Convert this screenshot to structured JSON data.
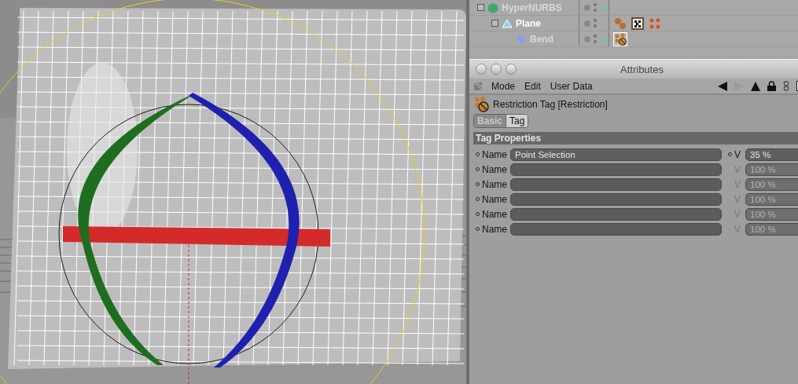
{
  "objects": [
    {
      "name": "HyperNURBS",
      "selected": false,
      "checked": true,
      "kind": "nurbs",
      "children": [
        {
          "name": "Plane",
          "selected": true,
          "checked": false,
          "kind": "plane",
          "tags": [
            {
              "kind": "balls",
              "selected": false
            },
            {
              "kind": "checker",
              "selected": false
            },
            {
              "kind": "dots",
              "selected": false
            }
          ],
          "children": [
            {
              "name": "Bend",
              "selected": false,
              "checked": true,
              "kind": "bend",
              "tags": [
                {
                  "kind": "restriction",
                  "selected": true
                }
              ]
            }
          ]
        }
      ]
    }
  ],
  "attributes": {
    "title": "Attributes",
    "menu": [
      "Mode",
      "Edit",
      "User Data"
    ],
    "object_title": "Restriction Tag [Restriction]",
    "tabs": [
      {
        "label": "Basic",
        "selected": false
      },
      {
        "label": "Tag",
        "selected": true
      }
    ],
    "section": "Tag Properties",
    "rows": [
      {
        "label": "Name",
        "value": "Point Selection",
        "v_label": "V",
        "v_value": "35 %",
        "disabled": false
      },
      {
        "label": "Name",
        "value": "",
        "v_label": "V",
        "v_value": "100 %",
        "disabled": true
      },
      {
        "label": "Name",
        "value": "",
        "v_label": "V",
        "v_value": "100 %",
        "disabled": true
      },
      {
        "label": "Name",
        "value": "",
        "v_label": "V",
        "v_value": "100 %",
        "disabled": true
      },
      {
        "label": "Name",
        "value": "",
        "v_label": "V",
        "v_value": "100 %",
        "disabled": true
      },
      {
        "label": "Name",
        "value": "",
        "v_label": "V",
        "v_value": "100 %",
        "disabled": true
      }
    ]
  }
}
